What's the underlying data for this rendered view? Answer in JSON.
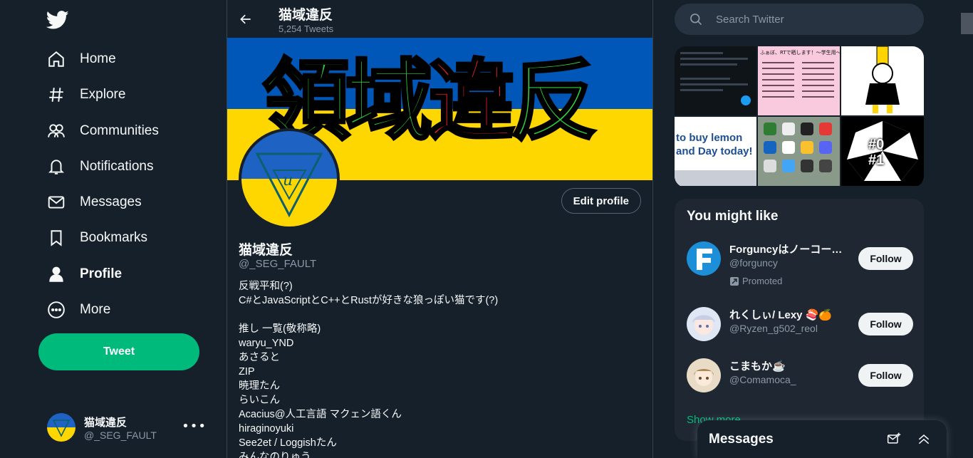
{
  "sidebar": {
    "logo": "twitter-bird-icon",
    "items": [
      {
        "label": "Home",
        "icon": "home-icon"
      },
      {
        "label": "Explore",
        "icon": "hashtag-icon"
      },
      {
        "label": "Communities",
        "icon": "communities-icon"
      },
      {
        "label": "Notifications",
        "icon": "bell-icon"
      },
      {
        "label": "Messages",
        "icon": "envelope-icon"
      },
      {
        "label": "Bookmarks",
        "icon": "bookmark-icon"
      },
      {
        "label": "Profile",
        "icon": "person-icon"
      },
      {
        "label": "More",
        "icon": "more-circle-icon"
      }
    ],
    "tweet_label": "Tweet",
    "account": {
      "name": "猫域違反",
      "handle": "@_SEG_FAULT"
    }
  },
  "header": {
    "title": "猫域違反",
    "tweet_count": "5,254 Tweets"
  },
  "profile": {
    "banner_text_green1": "領域",
    "banner_text_red": "違",
    "banner_text_green2": "反",
    "edit_label": "Edit profile",
    "name": "猫域違反",
    "handle": "@_SEG_FAULT",
    "bio": [
      "反戦平和(?)",
      "C#とJavaScriptとC++とRustが好きな狼っぽい猫です(?)",
      "",
      "推し 一覧(敬称略)",
      "waryu_YND",
      "あさると",
      "ZIP",
      "暁理たん",
      "らいこん",
      "Acacius@人工言語 マクェン語くん",
      "hiraginoyuki",
      "See2et / Loggishたん",
      "みんなのりゅう"
    ]
  },
  "right": {
    "search_placeholder": "Search Twitter",
    "media_tiles": [
      {
        "text": ""
      },
      {
        "text": "ふぁぼ、RTで晒します！〜学生用〜"
      },
      {
        "text": ""
      },
      {
        "text": "to buy lemon and Day today!"
      },
      {
        "text": ""
      },
      {
        "text": "#0 #1"
      }
    ],
    "wtf_title": "You might like",
    "wtf": [
      {
        "name": "Forguncyはノーコード…",
        "handle": "@forguncy",
        "promoted": "Promoted",
        "follow": "Follow"
      },
      {
        "name": "れくしぃ/ Lexy 🍣🍊",
        "handle": "@Ryzen_g502_reol",
        "follow": "Follow"
      },
      {
        "name": "こまもか☕",
        "handle": "@Comamoca_",
        "follow": "Follow"
      }
    ],
    "show_more": "Show more"
  },
  "drawer": {
    "title": "Messages"
  },
  "colors": {
    "accent": "#00ba7c",
    "background": "#15202b",
    "card": "#1e2732"
  }
}
